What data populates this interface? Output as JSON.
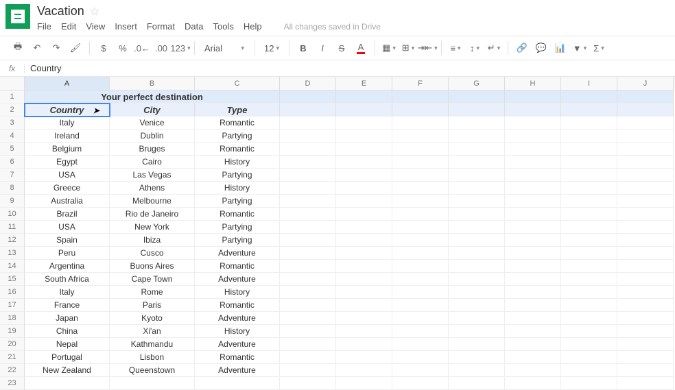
{
  "doc_title": "Vacation",
  "menu": [
    "File",
    "Edit",
    "View",
    "Insert",
    "Format",
    "Data",
    "Tools",
    "Help"
  ],
  "save_status": "All changes saved in Drive",
  "toolbar": {
    "font_name": "Arial",
    "font_size": "12"
  },
  "formula_bar": {
    "fx_label": "fx",
    "value": "Country"
  },
  "active_cell": "A2",
  "columns": [
    "A",
    "B",
    "C",
    "D",
    "E",
    "F",
    "G",
    "H",
    "I",
    "J"
  ],
  "col_widths_key": {
    "A": "cA",
    "B": "cB",
    "C": "cC",
    "D": "cW",
    "E": "cW",
    "F": "cW",
    "G": "cW",
    "H": "cW",
    "I": "cW",
    "J": "cW"
  },
  "sheet": {
    "title": "Your perfect destination",
    "headers": [
      "Country",
      "City",
      "Type"
    ],
    "rows": [
      [
        "Italy",
        "Venice",
        "Romantic"
      ],
      [
        "Ireland",
        "Dublin",
        "Partying"
      ],
      [
        "Belgium",
        "Bruges",
        "Romantic"
      ],
      [
        "Egypt",
        "Cairo",
        "History"
      ],
      [
        "USA",
        "Las Vegas",
        "Partying"
      ],
      [
        "Greece",
        "Athens",
        "History"
      ],
      [
        "Australia",
        "Melbourne",
        "Partying"
      ],
      [
        "Brazil",
        "Rio de Janeiro",
        "Romantic"
      ],
      [
        "USA",
        "New York",
        "Partying"
      ],
      [
        "Spain",
        "Ibiza",
        "Partying"
      ],
      [
        "Peru",
        "Cusco",
        "Adventure"
      ],
      [
        "Argentina",
        "Buons Aires",
        "Romantic"
      ],
      [
        "South Africa",
        "Cape Town",
        "Adventure"
      ],
      [
        "Italy",
        "Rome",
        "History"
      ],
      [
        "France",
        "Paris",
        "Romantic"
      ],
      [
        "Japan",
        "Kyoto",
        "Adventure"
      ],
      [
        "China",
        "Xi'an",
        "History"
      ],
      [
        "Nepal",
        "Kathmandu",
        "Adventure"
      ],
      [
        "Portugal",
        "Lisbon",
        "Romantic"
      ],
      [
        "New Zealand",
        "Queenstown",
        "Adventure"
      ]
    ]
  },
  "total_visible_rows": 23
}
